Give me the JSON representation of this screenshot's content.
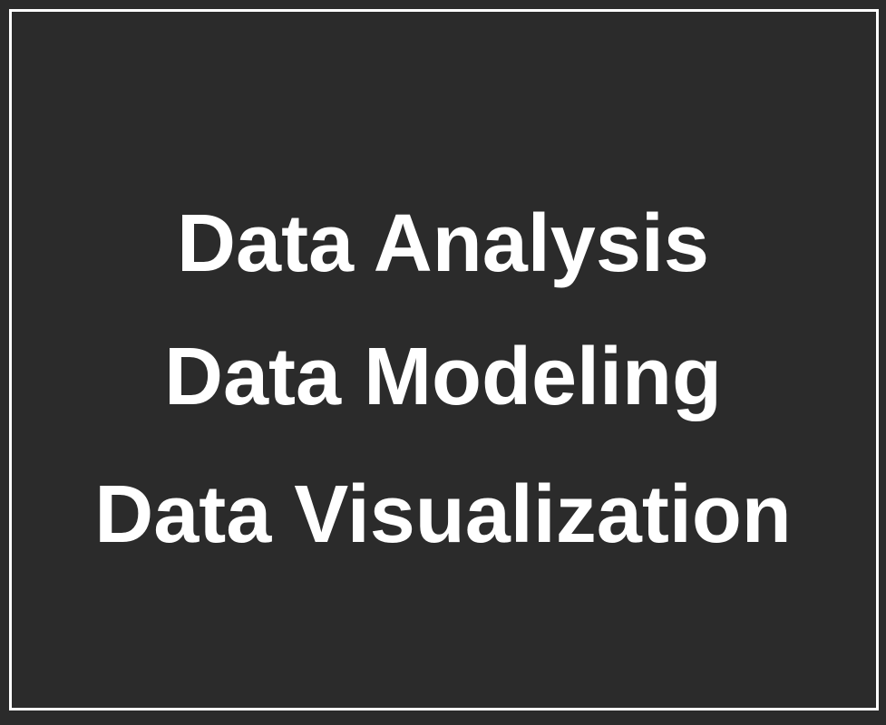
{
  "lines": [
    "Data Analysis",
    "Data Modeling",
    "Data Visualization"
  ],
  "colors": {
    "background": "#2b2b2b",
    "text": "#ffffff",
    "border": "#ffffff"
  }
}
